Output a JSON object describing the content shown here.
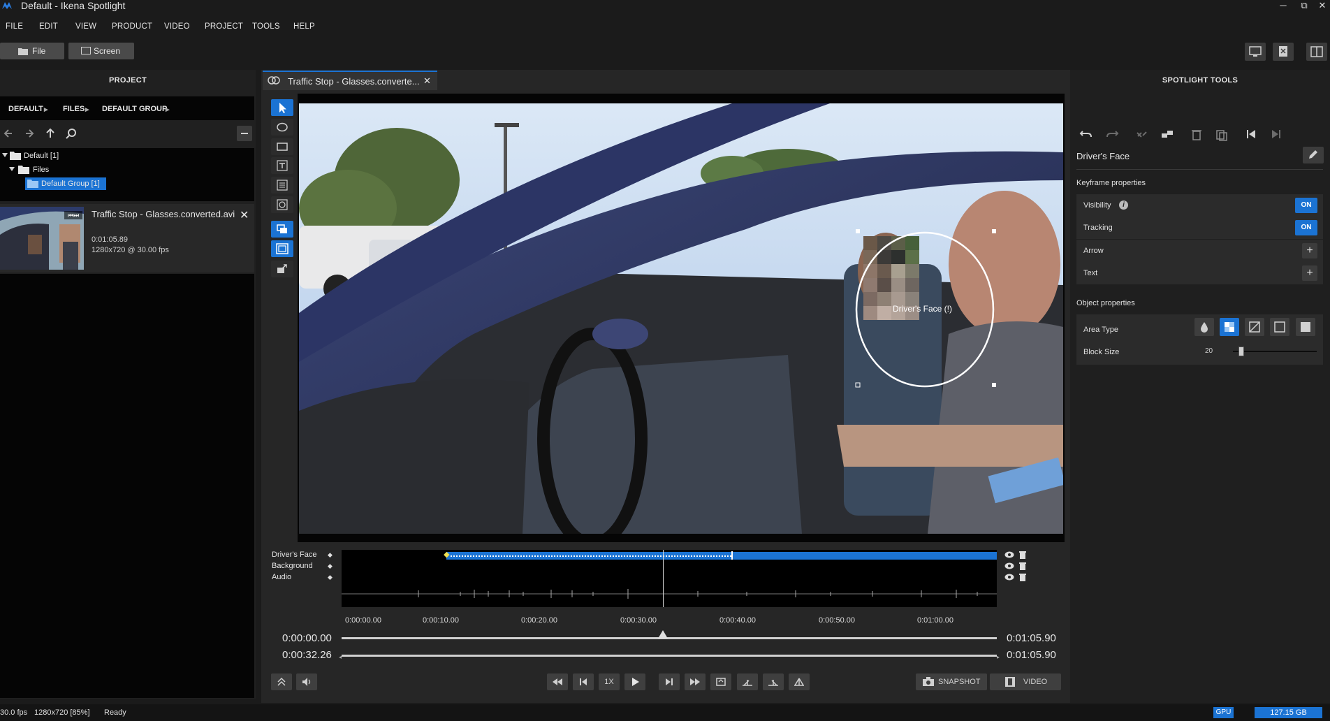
{
  "window": {
    "title": "Default - Ikena Spotlight",
    "minimize": "─",
    "restore": "⧉",
    "close": "✕"
  },
  "menu": [
    "FILE",
    "EDIT",
    "VIEW",
    "PRODUCT",
    "VIDEO",
    "PROJECT",
    "TOOLS",
    "HELP"
  ],
  "toolbar": {
    "file_label": "File",
    "screen_label": "Screen"
  },
  "project_panel": {
    "header": "PROJECT",
    "breadcrumb": [
      "DEFAULT",
      "FILES",
      "DEFAULT GROUP"
    ],
    "tree": {
      "root": "Default [1]",
      "files": "Files",
      "group": "Default Group [1]"
    },
    "file": {
      "name": "Traffic Stop - Glasses.converted.avi",
      "duration": "0:01:05.89",
      "resolution": "1280x720 @ 30.00 fps"
    }
  },
  "editor": {
    "tab_title": "Traffic Stop - Glasses.converte...",
    "overlay_label": "Driver's Face (!)",
    "tracks": [
      "Driver's Face",
      "Background",
      "Audio"
    ],
    "ticks": [
      "0:00:00.00",
      "0:00:10.00",
      "0:00:20.00",
      "0:00:30.00",
      "0:00:40.00",
      "0:00:50.00",
      "0:01:00.00"
    ],
    "time_start": "0:00:00.00",
    "time_current": "0:00:32.26",
    "time_end_1": "0:01:05.90",
    "time_end_2": "0:01:05.90",
    "speed": "1X",
    "snapshot_label": "SNAPSHOT",
    "video_label": "VIDEO",
    "playhead_fraction": 0.49,
    "keyframe_start_fraction": 0.16,
    "keyframe_end_fraction": 0.595
  },
  "spotlight_tools": {
    "header": "SPOTLIGHT TOOLS",
    "object_name": "Driver's Face",
    "keyframe_section": "Keyframe properties",
    "visibility_label": "Visibility",
    "visibility_value": "ON",
    "tracking_label": "Tracking",
    "tracking_value": "ON",
    "arrow_label": "Arrow",
    "text_label": "Text",
    "object_section": "Object properties",
    "area_type_label": "Area Type",
    "block_size_label": "Block Size",
    "block_size_value": "20",
    "block_size_fraction": 0.1
  },
  "status": {
    "fps": "30.0 fps",
    "resolution": "1280x720 [85%]",
    "state": "Ready",
    "gpu": "GPU",
    "disk": "127.15 GB"
  },
  "colors": {
    "accent": "#1b73d3",
    "background": "#1b1b1b",
    "panel": "#2b2b2b",
    "keyframe": "#f0e050"
  }
}
